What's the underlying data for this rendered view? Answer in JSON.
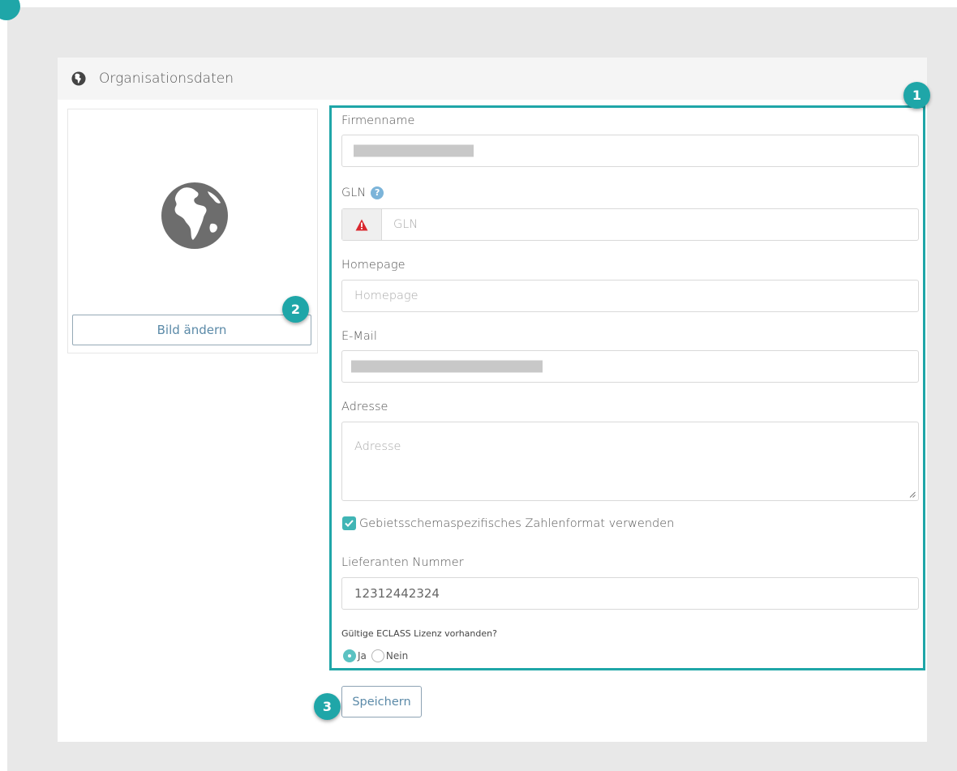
{
  "header": {
    "title": "Organisationsdaten",
    "icon": "globe-icon"
  },
  "image_card": {
    "change_button_label": "Bild ändern"
  },
  "form": {
    "firmenname": {
      "label": "Firmenname",
      "value_redacted": true
    },
    "gln": {
      "label": "GLN",
      "help_glyph": "?",
      "placeholder": "GLN",
      "status_icon": "warning-icon"
    },
    "homepage": {
      "label": "Homepage",
      "placeholder": "Homepage"
    },
    "email": {
      "label": "E-Mail",
      "value_redacted": true
    },
    "adresse": {
      "label": "Adresse",
      "placeholder": "Adresse"
    },
    "number_format_checkbox": {
      "label": "Gebietsschemaspezifisches Zahlenformat verwenden",
      "checked": true
    },
    "lieferanten_nummer": {
      "label": "Lieferanten Nummer",
      "value": "12312442324"
    },
    "eclass": {
      "question": "Gültige ECLASS Lizenz vorhanden?",
      "options": [
        {
          "label": "Ja",
          "selected": true
        },
        {
          "label": "Nein",
          "selected": false
        }
      ]
    }
  },
  "save_button_label": "Speichern",
  "badges": [
    "1",
    "2",
    "3"
  ],
  "colors": {
    "accent": "#1fa6a8",
    "button_text": "#5b8aa8",
    "warning": "#d9272e"
  }
}
